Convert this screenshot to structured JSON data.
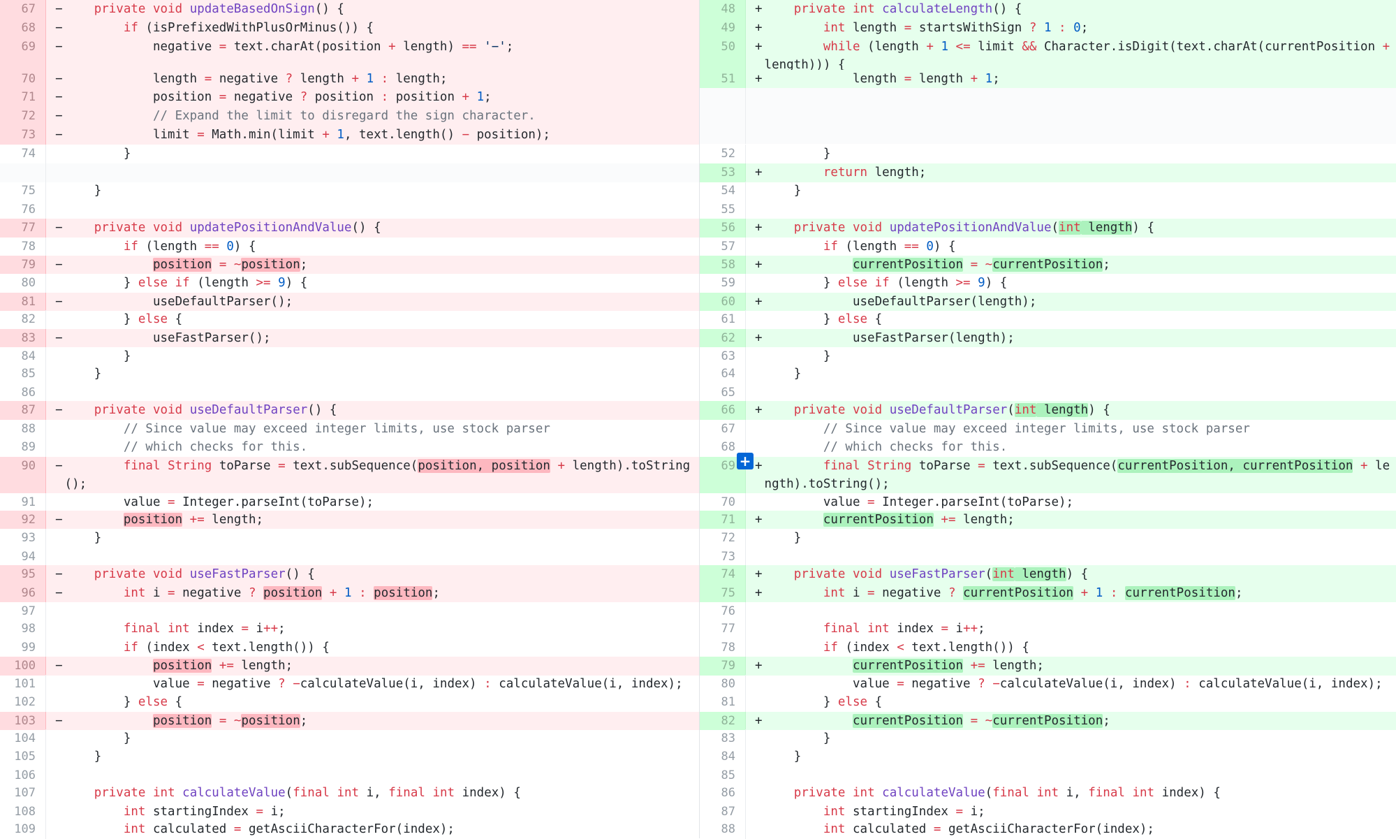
{
  "add_comment_label": "+",
  "left": [
    {
      "n": "67",
      "t": "del",
      "m": "−",
      "code": "    private void updateBasedOnSign() {"
    },
    {
      "n": "68",
      "t": "del",
      "m": "−",
      "code": "        if (isPrefixedWithPlusOrMinus()) {"
    },
    {
      "n": "69",
      "t": "del",
      "m": "−",
      "code": "            negative = text.charAt(position + length) == '−';"
    },
    {
      "n": "70",
      "t": "del",
      "m": "−",
      "code": "            length = negative ? length + 1 : length;"
    },
    {
      "n": "71",
      "t": "del",
      "m": "−",
      "code": "            position = negative ? position : position + 1;"
    },
    {
      "n": "72",
      "t": "del",
      "m": "−",
      "code": "            // Expand the limit to disregard the sign character."
    },
    {
      "n": "73",
      "t": "del",
      "m": "−",
      "code": "            limit = Math.min(limit + 1, text.length() − position);"
    },
    {
      "n": "74",
      "t": "ctx",
      "m": "",
      "code": "        }"
    },
    {
      "n": "",
      "t": "empty",
      "m": "",
      "code": ""
    },
    {
      "n": "75",
      "t": "ctx",
      "m": "",
      "code": "    }"
    },
    {
      "n": "76",
      "t": "ctx",
      "m": "",
      "code": ""
    },
    {
      "n": "77",
      "t": "del",
      "m": "−",
      "code": "    private void updatePositionAndValue() {"
    },
    {
      "n": "78",
      "t": "ctx",
      "m": "",
      "code": "        if (length == 0) {"
    },
    {
      "n": "79",
      "t": "del",
      "m": "−",
      "code": "            position = ~position;"
    },
    {
      "n": "80",
      "t": "ctx",
      "m": "",
      "code": "        } else if (length >= 9) {"
    },
    {
      "n": "81",
      "t": "del",
      "m": "−",
      "code": "            useDefaultParser();"
    },
    {
      "n": "82",
      "t": "ctx",
      "m": "",
      "code": "        } else {"
    },
    {
      "n": "83",
      "t": "del",
      "m": "−",
      "code": "            useFastParser();"
    },
    {
      "n": "84",
      "t": "ctx",
      "m": "",
      "code": "        }"
    },
    {
      "n": "85",
      "t": "ctx",
      "m": "",
      "code": "    }"
    },
    {
      "n": "86",
      "t": "ctx",
      "m": "",
      "code": ""
    },
    {
      "n": "87",
      "t": "del",
      "m": "−",
      "code": "    private void useDefaultParser() {"
    },
    {
      "n": "88",
      "t": "ctx",
      "m": "",
      "code": "        // Since value may exceed integer limits, use stock parser"
    },
    {
      "n": "89",
      "t": "ctx",
      "m": "",
      "code": "        // which checks for this."
    },
    {
      "n": "90",
      "t": "del",
      "m": "−",
      "code": "        final String toParse = text.subSequence(position, position + length).toString();"
    },
    {
      "n": "91",
      "t": "ctx",
      "m": "",
      "code": "        value = Integer.parseInt(toParse);"
    },
    {
      "n": "92",
      "t": "del",
      "m": "−",
      "code": "        position += length;"
    },
    {
      "n": "93",
      "t": "ctx",
      "m": "",
      "code": "    }"
    },
    {
      "n": "94",
      "t": "ctx",
      "m": "",
      "code": ""
    },
    {
      "n": "95",
      "t": "del",
      "m": "−",
      "code": "    private void useFastParser() {"
    },
    {
      "n": "96",
      "t": "del",
      "m": "−",
      "code": "        int i = negative ? position + 1 : position;"
    },
    {
      "n": "97",
      "t": "ctx",
      "m": "",
      "code": ""
    },
    {
      "n": "98",
      "t": "ctx",
      "m": "",
      "code": "        final int index = i++;"
    },
    {
      "n": "99",
      "t": "ctx",
      "m": "",
      "code": "        if (index < text.length()) {"
    },
    {
      "n": "100",
      "t": "del",
      "m": "−",
      "code": "            position += length;"
    },
    {
      "n": "101",
      "t": "ctx",
      "m": "",
      "code": "            value = negative ? −calculateValue(i, index) : calculateValue(i, index);"
    },
    {
      "n": "102",
      "t": "ctx",
      "m": "",
      "code": "        } else {"
    },
    {
      "n": "103",
      "t": "del",
      "m": "−",
      "code": "            position = ~position;"
    },
    {
      "n": "104",
      "t": "ctx",
      "m": "",
      "code": "        }"
    },
    {
      "n": "105",
      "t": "ctx",
      "m": "",
      "code": "    }"
    },
    {
      "n": "106",
      "t": "ctx",
      "m": "",
      "code": ""
    },
    {
      "n": "107",
      "t": "ctx",
      "m": "",
      "code": "    private int calculateValue(final int i, final int index) {"
    },
    {
      "n": "108",
      "t": "ctx",
      "m": "",
      "code": "        int startingIndex = i;"
    },
    {
      "n": "109",
      "t": "ctx",
      "m": "",
      "code": "        int calculated = getAsciiCharacterFor(index);"
    }
  ],
  "right": [
    {
      "n": "48",
      "t": "add",
      "m": "+",
      "code": "    private int calculateLength() {"
    },
    {
      "n": "49",
      "t": "add",
      "m": "+",
      "code": "        int length = startsWithSign ? 1 : 0;"
    },
    {
      "n": "50",
      "t": "add",
      "m": "+",
      "code": "        while (length + 1 <= limit && Character.isDigit(text.charAt(currentPosition + length))) {"
    },
    {
      "n": "51",
      "t": "add",
      "m": "+",
      "code": "            length = length + 1;"
    },
    {
      "n": "",
      "t": "empty",
      "m": "",
      "code": ""
    },
    {
      "n": "52",
      "t": "ctx",
      "m": "",
      "code": "        }"
    },
    {
      "n": "53",
      "t": "add",
      "m": "+",
      "code": "        return length;"
    },
    {
      "n": "54",
      "t": "ctx",
      "m": "",
      "code": "    }"
    },
    {
      "n": "55",
      "t": "ctx",
      "m": "",
      "code": ""
    },
    {
      "n": "56",
      "t": "add",
      "m": "+",
      "code": "    private void updatePositionAndValue(int length) {"
    },
    {
      "n": "57",
      "t": "ctx",
      "m": "",
      "code": "        if (length == 0) {"
    },
    {
      "n": "58",
      "t": "add",
      "m": "+",
      "code": "            currentPosition = ~currentPosition;"
    },
    {
      "n": "59",
      "t": "ctx",
      "m": "",
      "code": "        } else if (length >= 9) {"
    },
    {
      "n": "60",
      "t": "add",
      "m": "+",
      "code": "            useDefaultParser(length);"
    },
    {
      "n": "61",
      "t": "ctx",
      "m": "",
      "code": "        } else {"
    },
    {
      "n": "62",
      "t": "add",
      "m": "+",
      "code": "            useFastParser(length);"
    },
    {
      "n": "63",
      "t": "ctx",
      "m": "",
      "code": "        }"
    },
    {
      "n": "64",
      "t": "ctx",
      "m": "",
      "code": "    }"
    },
    {
      "n": "65",
      "t": "ctx",
      "m": "",
      "code": ""
    },
    {
      "n": "66",
      "t": "add",
      "m": "+",
      "code": "    private void useDefaultParser(int length) {"
    },
    {
      "n": "67",
      "t": "ctx",
      "m": "",
      "code": "        // Since value may exceed integer limits, use stock parser"
    },
    {
      "n": "68",
      "t": "ctx",
      "m": "",
      "code": "        // which checks for this."
    },
    {
      "n": "69",
      "t": "add",
      "m": "+",
      "code": "        final String toParse = text.subSequence(currentPosition, currentPosition + length).toString();"
    },
    {
      "n": "70",
      "t": "ctx",
      "m": "",
      "code": "        value = Integer.parseInt(toParse);"
    },
    {
      "n": "71",
      "t": "add",
      "m": "+",
      "code": "        currentPosition += length;"
    },
    {
      "n": "72",
      "t": "ctx",
      "m": "",
      "code": "    }"
    },
    {
      "n": "73",
      "t": "ctx",
      "m": "",
      "code": ""
    },
    {
      "n": "74",
      "t": "add",
      "m": "+",
      "code": "    private void useFastParser(int length) {"
    },
    {
      "n": "75",
      "t": "add",
      "m": "+",
      "code": "        int i = negative ? currentPosition + 1 : currentPosition;"
    },
    {
      "n": "76",
      "t": "ctx",
      "m": "",
      "code": ""
    },
    {
      "n": "77",
      "t": "ctx",
      "m": "",
      "code": "        final int index = i++;"
    },
    {
      "n": "78",
      "t": "ctx",
      "m": "",
      "code": "        if (index < text.length()) {"
    },
    {
      "n": "79",
      "t": "add",
      "m": "+",
      "code": "            currentPosition += length;"
    },
    {
      "n": "80",
      "t": "ctx",
      "m": "",
      "code": "            value = negative ? −calculateValue(i, index) : calculateValue(i, index);"
    },
    {
      "n": "81",
      "t": "ctx",
      "m": "",
      "code": "        } else {"
    },
    {
      "n": "82",
      "t": "add",
      "m": "+",
      "code": "            currentPosition = ~currentPosition;"
    },
    {
      "n": "83",
      "t": "ctx",
      "m": "",
      "code": "        }"
    },
    {
      "n": "84",
      "t": "ctx",
      "m": "",
      "code": "    }"
    },
    {
      "n": "85",
      "t": "ctx",
      "m": "",
      "code": ""
    },
    {
      "n": "86",
      "t": "ctx",
      "m": "",
      "code": "    private int calculateValue(final int i, final int index) {"
    },
    {
      "n": "87",
      "t": "ctx",
      "m": "",
      "code": "        int startingIndex = i;"
    },
    {
      "n": "88",
      "t": "ctx",
      "m": "",
      "code": "        int calculated = getAsciiCharacterFor(index);"
    }
  ]
}
